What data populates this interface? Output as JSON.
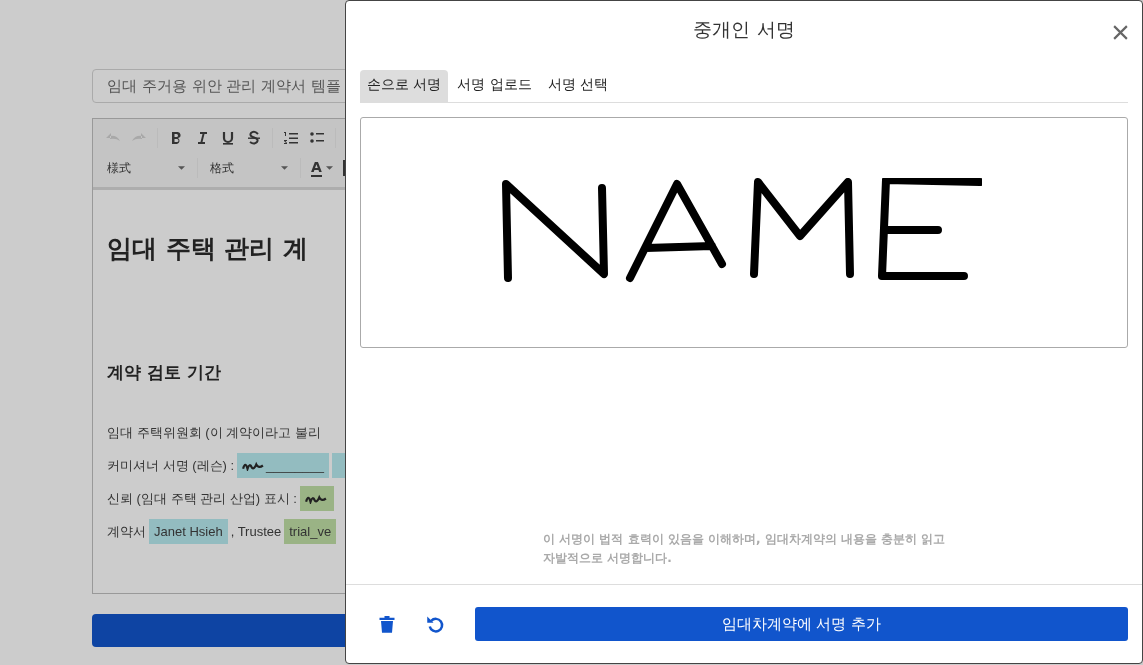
{
  "document": {
    "title_field": {
      "value": "임대 주거용 위안 관리 계약서 템플"
    },
    "toolbar": {
      "style_dropdown": "様式",
      "format_dropdown": "格式",
      "text_color": "A"
    },
    "heading": "임대 주택 관리 계",
    "section_heading": "계약 검토 기간",
    "lines": [
      {
        "kind": "text",
        "text": "임대 주택위원회 (이 계약이라고 불리"
      },
      {
        "kind": "fields",
        "label": "커미셔너 서명 (레슨) :",
        "chips": [
          {
            "kind": "signature",
            "text": "________",
            "color": "#93bcc0"
          },
          {
            "kind": "blank",
            "color": "#93bcc0"
          }
        ]
      },
      {
        "kind": "fields",
        "label": "신뢰 (임대 주택 관리 산업) 표시 :",
        "chips": [
          {
            "kind": "signature",
            "color": "#9ab385"
          }
        ]
      },
      {
        "kind": "mixed",
        "label": "계약서",
        "chips": [
          {
            "kind": "text",
            "text": "Janet Hsieh",
            "color": "#93bcc0"
          },
          {
            "kind": "joiner",
            "text": ", Trustee"
          },
          {
            "kind": "text",
            "text": "trial_ve",
            "color": "#9ab385"
          }
        ]
      }
    ]
  },
  "modal": {
    "title": "중개인 서명",
    "tabs": [
      {
        "label": "손으로 서명",
        "selected": true
      },
      {
        "label": "서명 업로드",
        "selected": false
      },
      {
        "label": "서명 선택",
        "selected": false
      }
    ],
    "disclaimer": "이 서명이 법적 효력이 있음을 이해하며, 임대차계약의 내용을 충분히 읽고 자발적으로 서명합니다.",
    "submit_button": "임대차계약에 서명 추가"
  }
}
